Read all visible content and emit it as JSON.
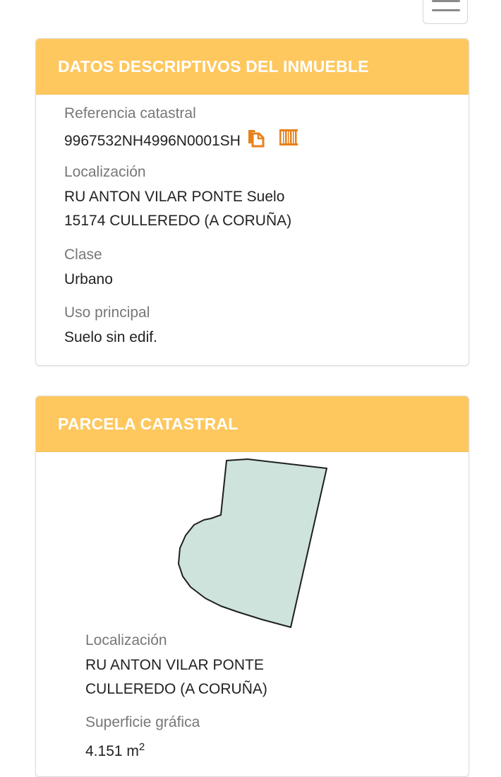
{
  "panel_datos": {
    "title": "DATOS DESCRIPTIVOS DEL INMUEBLE",
    "referencia_label": "Referencia catastral",
    "referencia_value": "9967532NH4996N0001SH",
    "localizacion_label": "Localización",
    "localizacion_line1": "RU ANTON VILAR PONTE Suelo",
    "localizacion_line2": "15174 CULLEREDO (A CORUÑA)",
    "clase_label": "Clase",
    "clase_value": "Urbano",
    "uso_label": "Uso principal",
    "uso_value": "Suelo sin edif."
  },
  "panel_parcela": {
    "title": "PARCELA CATASTRAL",
    "localizacion_label": "Localización",
    "localizacion_line1": "RU ANTON VILAR PONTE",
    "localizacion_line2": "CULLEREDO (A CORUÑA)",
    "superficie_label": "Superficie gráfica",
    "superficie_value": "4.151 m",
    "superficie_exp": "2"
  },
  "icons": [
    "menu-icon",
    "copy-icon",
    "barcode-icon"
  ],
  "colors": {
    "header_bg": "#fec85f",
    "accent_orange": "#e8811a",
    "parcel_fill": "#cde3dc"
  }
}
